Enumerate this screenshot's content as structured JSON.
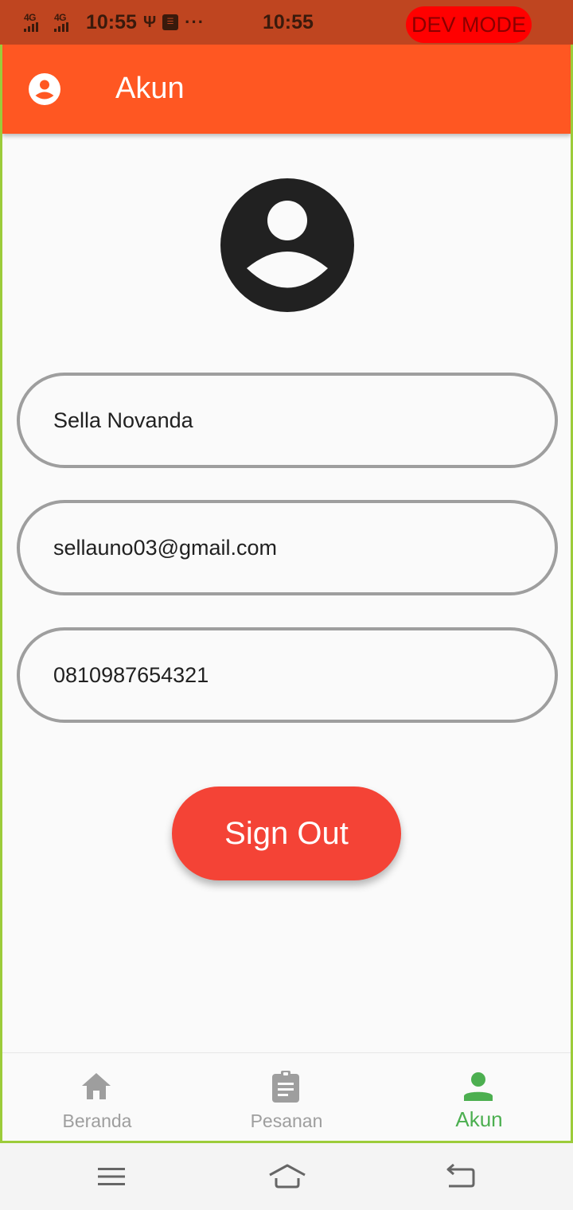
{
  "status_bar": {
    "network_1": "4G",
    "network_2": "4G",
    "time_left": "10:55",
    "usb_symbol": "Ψ",
    "notif_box": "☰",
    "dots": "···",
    "time_center": "10:55",
    "dev_mode": "DEV MODE"
  },
  "app_bar": {
    "title": "Akun"
  },
  "profile": {
    "name": "Sella Novanda",
    "email": "sellauno03@gmail.com",
    "phone": "0810987654321"
  },
  "actions": {
    "sign_out": "Sign Out"
  },
  "bottom_nav": [
    {
      "label": "Beranda",
      "icon": "home-icon",
      "active": false
    },
    {
      "label": "Pesanan",
      "icon": "assignment-icon",
      "active": false
    },
    {
      "label": "Akun",
      "icon": "person-icon",
      "active": true
    }
  ],
  "colors": {
    "app_bar": "#ff5722",
    "status_bar": "#bf4520",
    "sign_out": "#f44336",
    "nav_active": "#4caf50",
    "nav_inactive": "#9e9e9e"
  }
}
